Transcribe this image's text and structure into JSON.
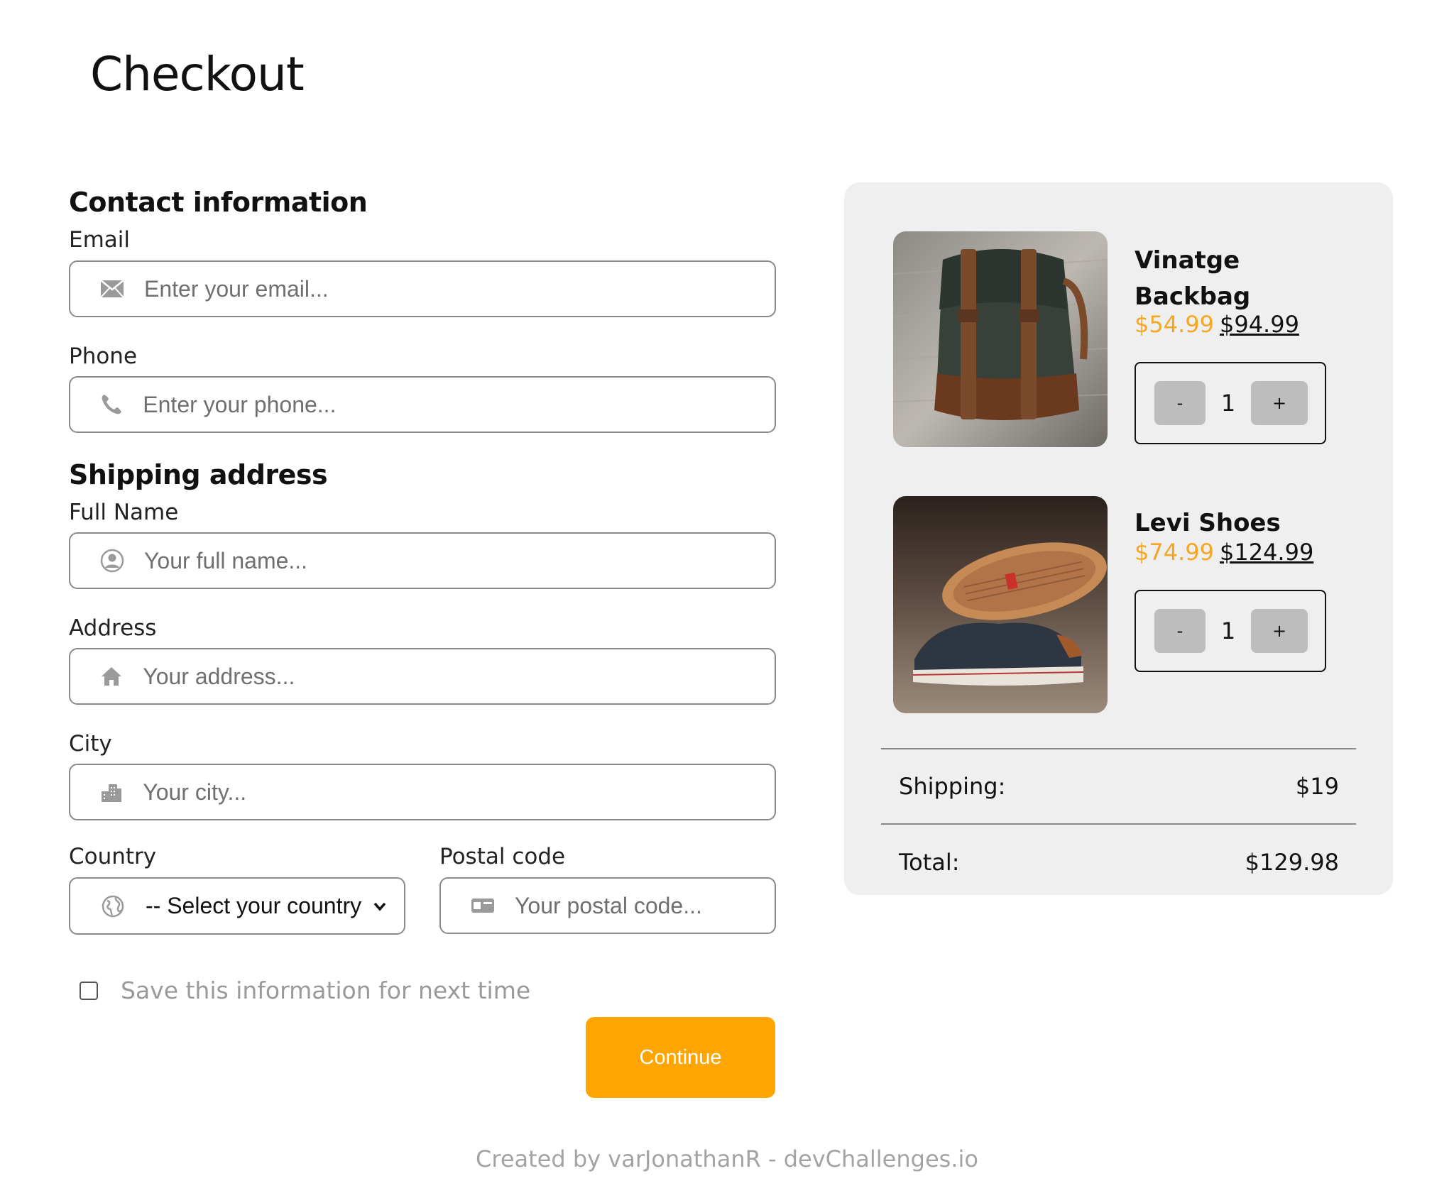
{
  "page": {
    "title": "Checkout"
  },
  "contact": {
    "heading": "Contact information",
    "email": {
      "label": "Email",
      "placeholder": "Enter your email...",
      "icon": "mail-icon"
    },
    "phone": {
      "label": "Phone",
      "placeholder": "Enter your phone...",
      "icon": "phone-icon"
    }
  },
  "shipping": {
    "heading": "Shipping address",
    "full_name": {
      "label": "Full Name",
      "placeholder": "Your full name...",
      "icon": "user-circle-icon"
    },
    "address": {
      "label": "Address",
      "placeholder": "Your address...",
      "icon": "home-icon"
    },
    "city": {
      "label": "City",
      "placeholder": "Your city...",
      "icon": "city-icon"
    },
    "country": {
      "label": "Country",
      "selected": "-- Select your country",
      "icon": "globe-icon"
    },
    "postal": {
      "label": "Postal code",
      "placeholder": "Your postal code...",
      "icon": "postal-card-icon"
    }
  },
  "save_info": {
    "label": "Save this information for next time",
    "checked": false
  },
  "continue_button": {
    "label": "Continue"
  },
  "summary": {
    "products": [
      {
        "name": "Vinatge Backbag",
        "price": "$54.99",
        "original_price": "$94.99",
        "quantity": "1",
        "minus": "-",
        "plus": "+"
      },
      {
        "name": "Levi Shoes",
        "price": "$74.99",
        "original_price": "$124.99",
        "quantity": "1",
        "minus": "-",
        "plus": "+"
      }
    ],
    "shipping_label": "Shipping:",
    "shipping_value": "$19",
    "total_label": "Total:",
    "total_value": "$129.98"
  },
  "footer": {
    "text": "Created by varJonathanR - devChallenges.io"
  },
  "colors": {
    "accent": "#ffa500",
    "sale_price": "#f5a623",
    "summary_bg": "#efefef"
  }
}
